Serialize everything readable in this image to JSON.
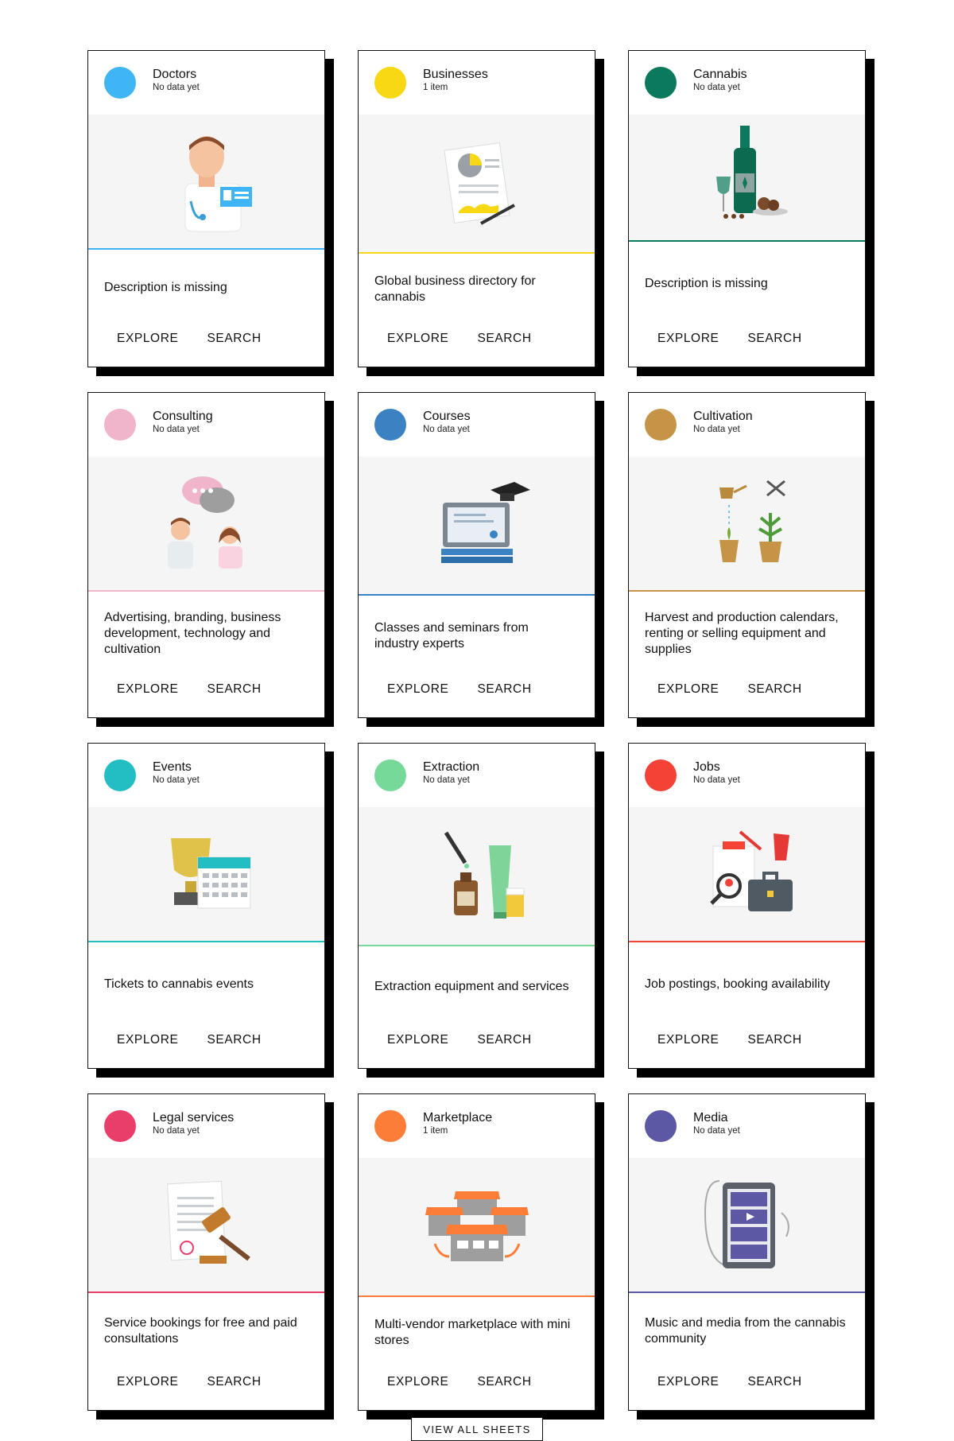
{
  "cards": [
    {
      "title": "Doctors",
      "count": "No data yet",
      "description": "Description is missing",
      "color": "#3fb5f5",
      "icon": "doctor-icon",
      "explore": "EXPLORE",
      "search": "SEARCH"
    },
    {
      "title": "Businesses",
      "count": "1 item",
      "description": "Global business directory for cannabis",
      "color": "#f7d813",
      "icon": "business-report-icon",
      "explore": "EXPLORE",
      "search": "SEARCH"
    },
    {
      "title": "Cannabis",
      "count": "No data yet",
      "description": "Description is missing",
      "color": "#0b7a5c",
      "icon": "wine-bottle-icon",
      "explore": "EXPLORE",
      "search": "SEARCH"
    },
    {
      "title": "Consulting",
      "count": "No data yet",
      "description": "Advertising, branding, business development, technology and cultivation",
      "color": "#f0b5cb",
      "icon": "consultants-icon",
      "explore": "EXPLORE",
      "search": "SEARCH"
    },
    {
      "title": "Courses",
      "count": "No data yet",
      "description": "Classes and seminars from industry experts",
      "color": "#3b82c2",
      "icon": "graduation-laptop-icon",
      "explore": "EXPLORE",
      "search": "SEARCH"
    },
    {
      "title": "Cultivation",
      "count": "No data yet",
      "description": "Harvest and production calendars, renting or selling equipment and supplies",
      "color": "#c59447",
      "icon": "plant-pots-icon",
      "explore": "EXPLORE",
      "search": "SEARCH"
    },
    {
      "title": "Events",
      "count": "No data yet",
      "description": "Tickets to cannabis events",
      "color": "#23bec3",
      "icon": "trophy-calendar-icon",
      "explore": "EXPLORE",
      "search": "SEARCH"
    },
    {
      "title": "Extraction",
      "count": "No data yet",
      "description": "Extraction equipment and services",
      "color": "#76d99a",
      "icon": "extraction-bottles-icon",
      "explore": "EXPLORE",
      "search": "SEARCH"
    },
    {
      "title": "Jobs",
      "count": "No data yet",
      "description": "Job postings, booking availability",
      "color": "#f44336",
      "icon": "job-tools-icon",
      "explore": "EXPLORE",
      "search": "SEARCH"
    },
    {
      "title": "Legal services",
      "count": "No data yet",
      "description": "Service bookings for free and paid consultations",
      "color": "#ea3e6a",
      "icon": "gavel-document-icon",
      "explore": "EXPLORE",
      "search": "SEARCH"
    },
    {
      "title": "Marketplace",
      "count": "1 item",
      "description": "Multi-vendor marketplace with mini stores",
      "color": "#fb7d37",
      "icon": "storefronts-icon",
      "explore": "EXPLORE",
      "search": "SEARCH"
    },
    {
      "title": "Media",
      "count": "No data yet",
      "description": "Music and media from the cannabis community",
      "color": "#5c58a3",
      "icon": "media-tablet-icon",
      "explore": "EXPLORE",
      "search": "SEARCH"
    }
  ],
  "footer": {
    "view_all_label": "VIEW ALL SHEETS"
  }
}
